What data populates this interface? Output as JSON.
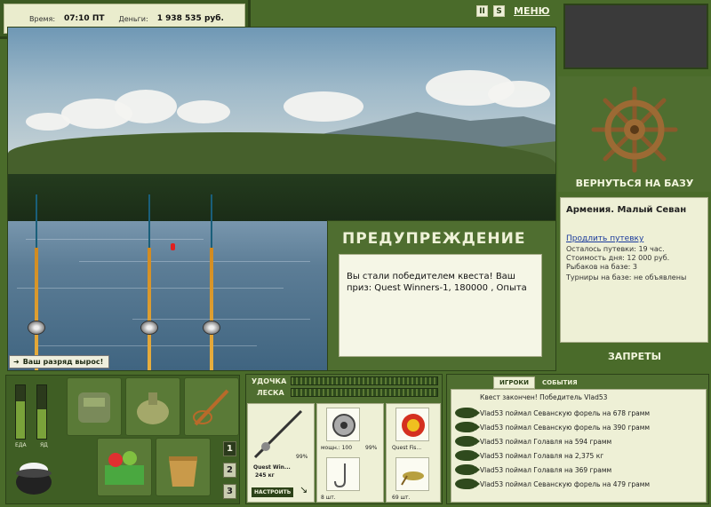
{
  "status": {
    "time_label": "Время:",
    "time_value": "07:10 ПТ",
    "money_label": "Деньги:",
    "money_value": "1 938 535 руб."
  },
  "controls": {
    "pause_label": "II",
    "sound_label": "S",
    "menu_label": "МЕНЮ"
  },
  "scene": {
    "rank_message": "Ваш разряд вырос!"
  },
  "dialog": {
    "title": "ПРЕДУПРЕЖДЕНИЕ",
    "body": "Вы стали победителем квеста! Ваш приз: Quest Winners-1, 180000 , Опыта"
  },
  "right_panel": {
    "return_label": "ВЕРНУТЬСЯ НА БАЗУ",
    "location": "Армения. Малый Севан",
    "extend_link": "Продлить путевку",
    "info_lines": [
      "Осталось путевки: 19 час.",
      "Стоимость дня: 12 000 руб.",
      "Рыбаков на базе: 3",
      "Турниры на базе: не объявлены"
    ],
    "bans_label": "ЗАПРЕТЫ"
  },
  "inventory": {
    "food_label": "ЕДА",
    "poison_label": "ЯД",
    "food_level": 0.7,
    "poison_level": 0.55,
    "pages": [
      "1",
      "2",
      "3"
    ],
    "active_page": "1"
  },
  "gear": {
    "rod_label": "УДОЧКА",
    "line_label": "ЛЕСКА",
    "rod_name": "Quest Win...",
    "rod_weight": "245 кг",
    "rod_percent": "99%",
    "reel_power": "мощн.: 100",
    "reel_percent": "99%",
    "line_name": "Quest Fis...",
    "hook_count": "8 шт.",
    "bait_count": "69 шт.",
    "setup_label": "НАСТРОИТЬ"
  },
  "log": {
    "tab_players": "ИГРОКИ",
    "tab_events": "СОБЫТИЯ",
    "header": "Квест закончен! Победитель Vlad53",
    "entries": [
      "Vlad53 поймал Севанскую форель на 678 грамм",
      "Vlad53 поймал Севанскую форель на 390 грамм",
      "Vlad53 поймал Голавля на 594 грамм",
      "Vlad53 поймал Голавля на 2,375 кг",
      "Vlad53 поймал Голавля на 369 грамм",
      "Vlad53 поймал Севанскую форель на 479 грамм"
    ]
  }
}
